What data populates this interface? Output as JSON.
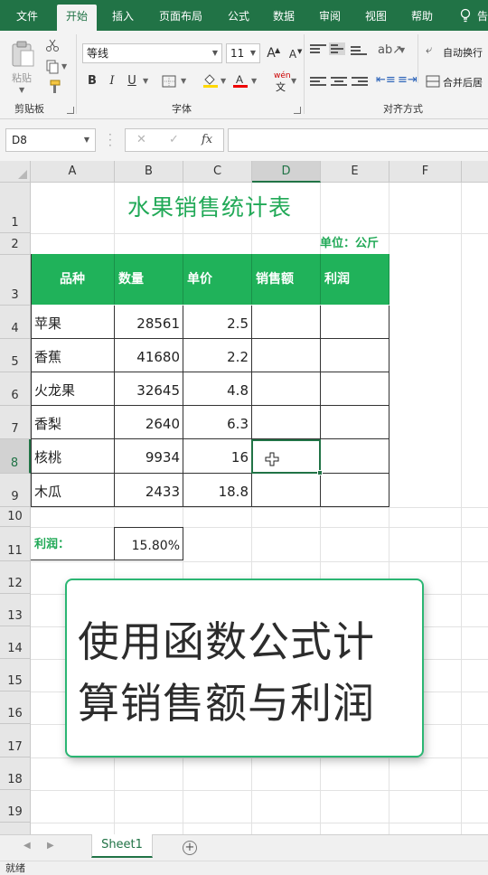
{
  "menu": {
    "tabs": [
      "文件",
      "开始",
      "插入",
      "页面布局",
      "公式",
      "数据",
      "审阅",
      "视图",
      "帮助"
    ],
    "active": "开始",
    "search_partial": "告"
  },
  "ribbon": {
    "paste_label": "粘贴",
    "clipboard_group": "剪贴板",
    "font_group": "字体",
    "align_group": "对齐方式",
    "font_name": "等线",
    "font_size": "11",
    "bold": "B",
    "italic": "I",
    "underline": "U",
    "wrap_text": "自动换行",
    "merge_center": "合并后居",
    "grow_font": "A",
    "shrink_font": "A",
    "phonetic": "wén",
    "phonetic_zh": "文"
  },
  "formula_bar": {
    "name_box": "D8",
    "fx": "fx",
    "value": ""
  },
  "grid": {
    "columns": [
      "A",
      "B",
      "C",
      "D",
      "E",
      "F"
    ],
    "selected_column": "D",
    "rows": [
      "1",
      "2",
      "3",
      "4",
      "5",
      "6",
      "7",
      "8",
      "9",
      "10",
      "11",
      "12",
      "13",
      "14",
      "15",
      "16",
      "17",
      "18",
      "19"
    ],
    "selected_row": "8"
  },
  "sheet": {
    "title": "水果销售统计表",
    "unit": "单位：公斤",
    "headers": [
      "品种",
      "数量",
      "单价",
      "销售额",
      "利润"
    ],
    "rows": [
      {
        "name": "苹果",
        "qty": "28561",
        "price": "2.5"
      },
      {
        "name": "香蕉",
        "qty": "41680",
        "price": "2.2"
      },
      {
        "name": "火龙果",
        "qty": "32645",
        "price": "4.8"
      },
      {
        "name": "香梨",
        "qty": "2640",
        "price": "6.3"
      },
      {
        "name": "核桃",
        "qty": "9934",
        "price": "16"
      },
      {
        "name": "木瓜",
        "qty": "2433",
        "price": "18.8"
      }
    ],
    "profit_label": "利润：",
    "profit_value": "15.80%"
  },
  "overlay": {
    "line1": "使用函数公式计",
    "line2": "算销售额与利润"
  },
  "sheet_tabs": {
    "active": "Sheet1",
    "add": "+"
  },
  "status": {
    "text": "就绪"
  },
  "colors": {
    "excel_green": "#217346",
    "accent_green": "#21a957",
    "header_fill": "#20b25a"
  }
}
